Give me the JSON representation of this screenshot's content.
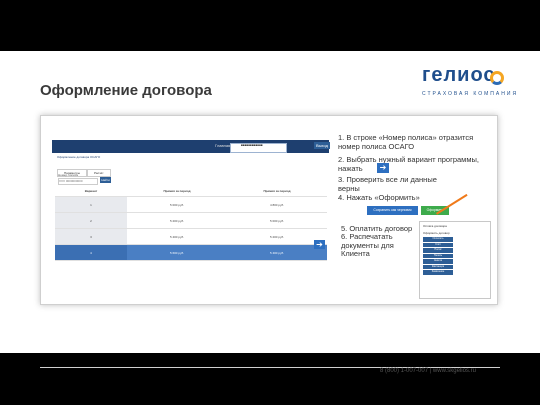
{
  "page_title": "Оформление договора",
  "logo": {
    "word": "гелиос",
    "tagline": "СТРАХОВАЯ КОМПАНИЯ"
  },
  "screenshot": {
    "nav_text": "Главная",
    "badge_text": "■■■■■■■■■■■■",
    "exit_label": "Выход",
    "header": "Оформление договора ОСАГО",
    "tabs": [
      "Параметры",
      "Расчёт"
    ],
    "field_label": "Номер полиса",
    "field_placeholder": "XXX 0000000000",
    "search_label": "Найти",
    "table_header": [
      "Вариант",
      "Премия за период",
      "Премия за период"
    ],
    "rows": [
      [
        "1",
        "5 000 руб.",
        "4 800 руб."
      ],
      [
        "2",
        "5 200 руб.",
        "5 000 руб."
      ],
      [
        "3",
        "5 400 руб.",
        "5 200 руб."
      ],
      [
        "4",
        "5 600 руб.",
        "5 400 руб."
      ]
    ]
  },
  "steps": [
    "1.  В строке «Номер полиса» отразится",
    "     номер полиса ОСАГО",
    "2.  Выбрать нужный вариант программы,",
    "     нажать",
    "3.  Проверить все ли данные",
    "     верны",
    "4.  Нажать «Оформить»"
  ],
  "buttons": {
    "compare": "Сохранить как черновик",
    "issue": "Оформить"
  },
  "steps2": [
    "5.  Оплатить договор",
    "6.  Распечатать",
    "     документы для",
    "     Клиента"
  ],
  "panel": {
    "header": "Оплата договора",
    "sub": "Оформить договор",
    "buttons": [
      "Оплатить",
      "Счёт",
      "Полис",
      "Печать",
      "Анкета",
      "Квитанция",
      "Заявление"
    ]
  },
  "footer": "8 (800) 1-007-007   |   www.skgelios.ru",
  "colors": {
    "brand_blue": "#1f4e8c",
    "accent_orange": "#f5a623",
    "issue_green": "#3eab4c",
    "selected_row": "#4a7fc4"
  }
}
